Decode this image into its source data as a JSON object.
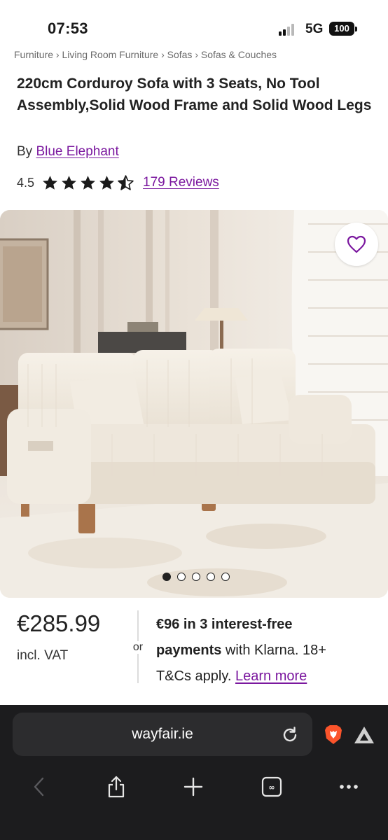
{
  "status_bar": {
    "time": "07:53",
    "network": "5G",
    "battery": "100"
  },
  "breadcrumb": "Furniture › Living Room Furniture › Sofas › Sofas & Couches",
  "product": {
    "title": "220cm Corduroy Sofa with 3 Seats, No Tool Assembly,Solid Wood Frame and Solid Wood Legs",
    "brand_prefix": "By",
    "brand": "Blue Elephant",
    "rating": "4.5",
    "rating_value": 4.5,
    "rating_max": 5,
    "reviews_label": "179 Reviews",
    "image_count": 5,
    "active_image": 1
  },
  "price": {
    "amount": "€285.99",
    "vat_note": "incl. VAT",
    "or_label": "or",
    "klarna_amount": "€96 in 3 interest-free",
    "klarna_payments": "payments",
    "klarna_rest": " with Klarna. 18+",
    "klarna_terms": "T&Cs apply. ",
    "learn_more": "Learn more"
  },
  "browser": {
    "url": "wayfair.ie"
  },
  "icons": {
    "favorite": "heart-outline-icon",
    "reload": "reload-icon",
    "brave": "brave-lion-icon",
    "rewards": "brave-rewards-icon",
    "back": "chevron-left-icon",
    "share": "share-icon",
    "new_tab": "plus-icon",
    "tabs": "tab-switcher-icon",
    "menu": "more-dots-icon"
  },
  "colors": {
    "brand_purple": "#7b189f",
    "star": "#1a1a1a",
    "browser_chrome": "#1c1c1e"
  }
}
